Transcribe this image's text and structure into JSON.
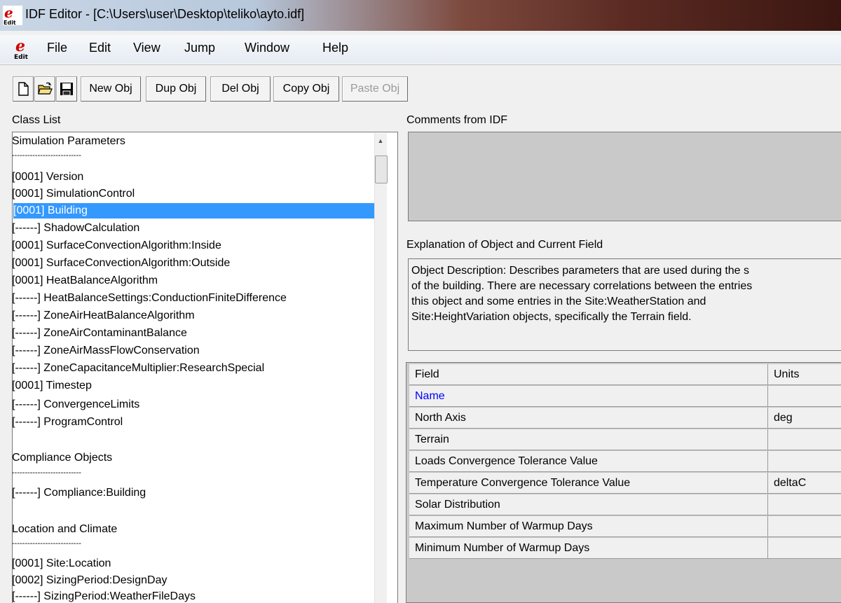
{
  "window": {
    "title": "IDF Editor - [C:\\Users\\user\\Desktop\\teliko\\ayto.idf]",
    "icon": "idf-editor-app-icon"
  },
  "menu": {
    "items": [
      "File",
      "Edit",
      "View",
      "Jump",
      "Window",
      "Help"
    ]
  },
  "toolbar": {
    "new_file_icon": "new-document-icon",
    "open_file_icon": "open-folder-icon",
    "save_file_icon": "save-floppy-icon",
    "new_obj": "New Obj",
    "dup_obj": "Dup Obj",
    "del_obj": "Del Obj",
    "copy_obj": "Copy Obj",
    "paste_obj": "Paste Obj"
  },
  "class_list": {
    "label": "Class List",
    "items": [
      "Simulation Parameters",
      "---------------------------",
      "[0001]  Version",
      "[0001]  SimulationControl",
      "[0001]  Building",
      "[------]  ShadowCalculation",
      "[0001]  SurfaceConvectionAlgorithm:Inside",
      "[0001]  SurfaceConvectionAlgorithm:Outside",
      "[0001]  HeatBalanceAlgorithm",
      "[------]  HeatBalanceSettings:ConductionFiniteDifference",
      "[------]  ZoneAirHeatBalanceAlgorithm",
      "[------]  ZoneAirContaminantBalance",
      "[------]  ZoneAirMassFlowConservation",
      "[------]  ZoneCapacitanceMultiplier:ResearchSpecial",
      "[0001]  Timestep",
      "[------]  ConvergenceLimits",
      "[------]  ProgramControl",
      "",
      "Compliance Objects",
      "---------------------------",
      "[------]  Compliance:Building",
      "",
      "Location and Climate",
      "---------------------------",
      "[0001]  Site:Location",
      "[0002]  SizingPeriod:DesignDay",
      "[------]  SizingPeriod:WeatherFileDays"
    ],
    "selected_index": 4
  },
  "comments": {
    "label": "Comments from IDF",
    "text": ""
  },
  "explanation": {
    "label": "Explanation of Object and Current Field",
    "lines": [
      "Object Description: Describes parameters that are used during the s",
      "of the building. There are necessary correlations between the entries",
      "this object and some entries in the Site:WeatherStation and",
      "Site:HeightVariation objects, specifically the Terrain field."
    ]
  },
  "grid": {
    "header_field": "Field",
    "header_units": "Units",
    "rows": [
      {
        "field": "Name",
        "units": ""
      },
      {
        "field": "North Axis",
        "units": "deg"
      },
      {
        "field": "Terrain",
        "units": ""
      },
      {
        "field": "Loads Convergence Tolerance Value",
        "units": ""
      },
      {
        "field": "Temperature Convergence Tolerance Value",
        "units": "deltaC"
      },
      {
        "field": "Solar Distribution",
        "units": ""
      },
      {
        "field": "Maximum Number of Warmup Days",
        "units": ""
      },
      {
        "field": "Minimum Number of Warmup Days",
        "units": ""
      }
    ]
  }
}
